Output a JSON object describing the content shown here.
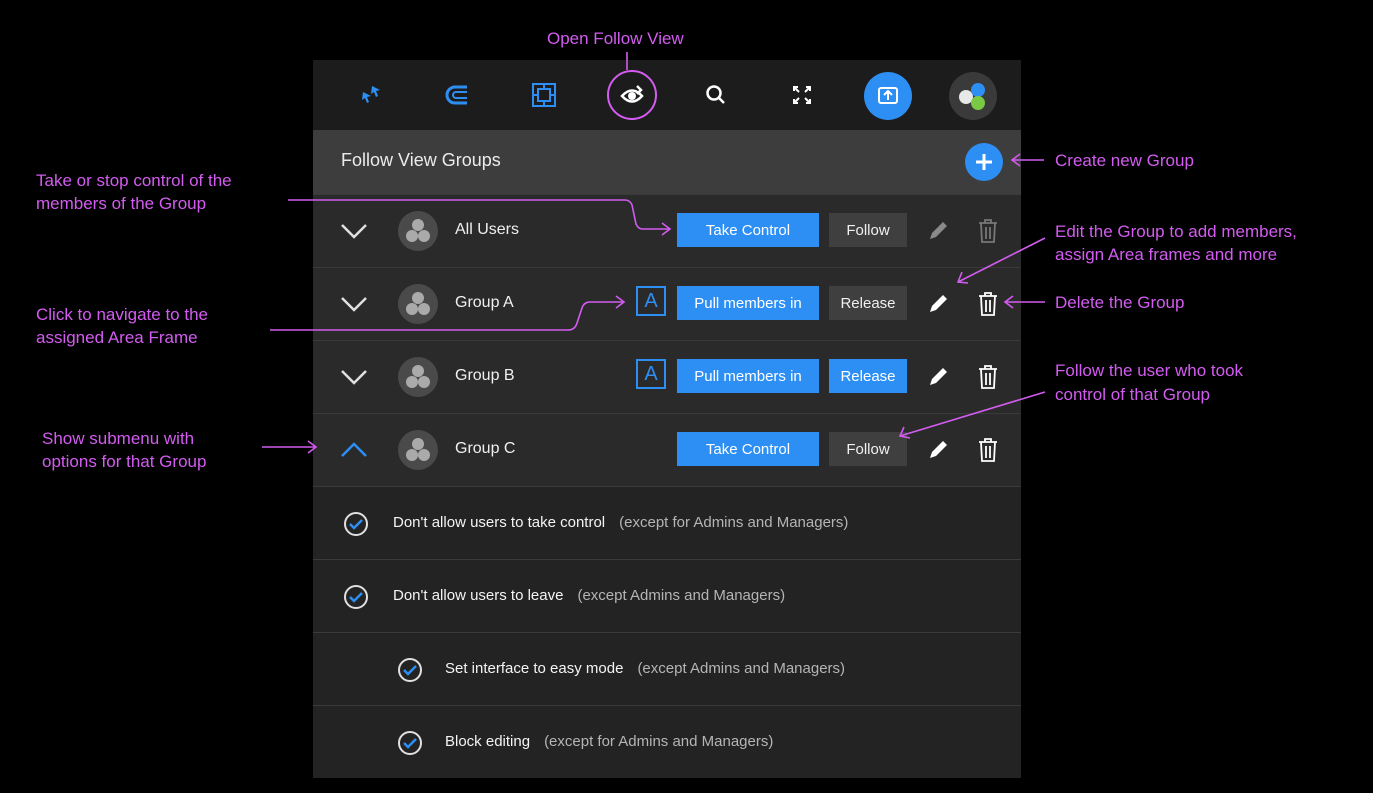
{
  "toolbar": {
    "tools": [
      {
        "icon": "pointer-arrows-icon"
      },
      {
        "icon": "magnet-icon"
      },
      {
        "icon": "frame-icon"
      },
      {
        "icon": "follow-view-eye-icon"
      },
      {
        "icon": "search-icon"
      },
      {
        "icon": "fullscreen-icon"
      },
      {
        "icon": "share-screen-icon"
      },
      {
        "icon": "apps-dots-icon"
      }
    ]
  },
  "panel": {
    "title": "Follow View Groups",
    "add_icon": "plus-icon"
  },
  "groups": [
    {
      "name": "All Users",
      "primary": "Take Control",
      "secondary": "Follow",
      "expanded": false,
      "has_area": false
    },
    {
      "name": "Group A",
      "primary": "Pull members in",
      "secondary": "Release",
      "expanded": false,
      "has_area": true,
      "area_label": "A"
    },
    {
      "name": "Group B",
      "primary": "Pull members in",
      "secondary": "Release",
      "expanded": false,
      "has_area": true,
      "area_label": "A"
    },
    {
      "name": "Group C",
      "primary": "Take Control",
      "secondary": "Follow",
      "expanded": true,
      "has_area": false
    }
  ],
  "options": [
    {
      "label": "Don't allow users to take control",
      "note": "(except for Admins and Managers)",
      "checked": true
    },
    {
      "label": "Don't allow users to leave",
      "note": "(except Admins and Managers)",
      "checked": true
    },
    {
      "label": "Set interface to easy mode",
      "note": "(except Admins and Managers)",
      "checked": true
    },
    {
      "label": "Block editing",
      "note": "(except for Admins and Managers)",
      "checked": true
    }
  ],
  "annotations": {
    "open_follow_view": "Open Follow View",
    "create_group": "Create new Group",
    "take_control_1": "Take or stop control of the",
    "take_control_2": "members of the Group",
    "edit_group_1": "Edit the Group to add members,",
    "edit_group_2": "assign Area frames and more",
    "navigate_area_1": "Click to navigate to the",
    "navigate_area_2": "assigned Area Frame",
    "delete_group": "Delete the Group",
    "follow_user_1": "Follow the user who took",
    "follow_user_2": "control of that Group",
    "submenu_1": "Show submenu with",
    "submenu_2": "options for that Group"
  },
  "colors": {
    "accent": "#2d8ff3",
    "annotation": "#d35cf0",
    "panel": "#2a2a2a",
    "header": "#3d3d3d"
  }
}
